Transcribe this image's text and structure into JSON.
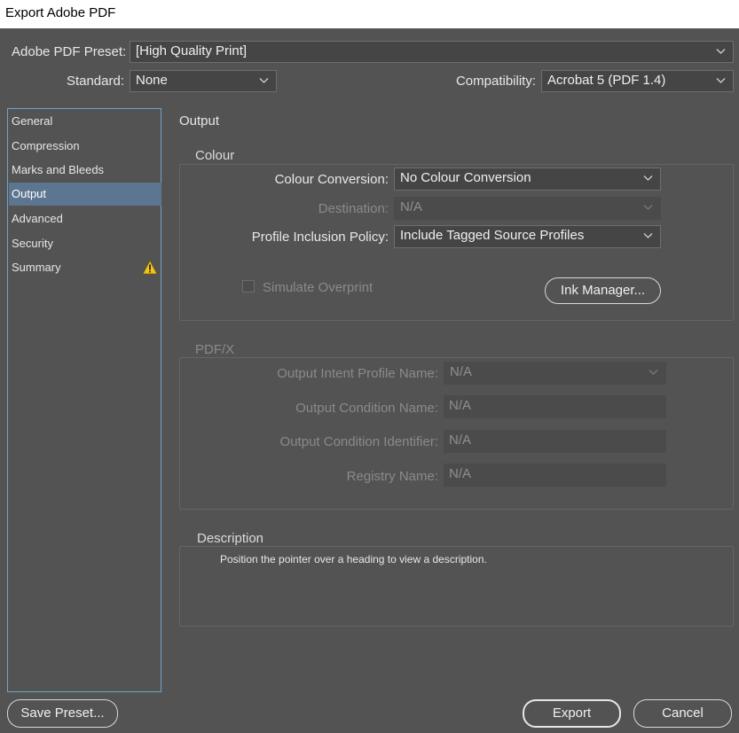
{
  "window": {
    "title": "Export Adobe PDF"
  },
  "header": {
    "preset_label": "Adobe PDF Preset:",
    "preset_value": "[High Quality Print]",
    "standard_label": "Standard:",
    "standard_value": "None",
    "compat_label": "Compatibility:",
    "compat_value": "Acrobat 5 (PDF 1.4)"
  },
  "sidebar": {
    "items": [
      {
        "label": "General"
      },
      {
        "label": "Compression"
      },
      {
        "label": "Marks and Bleeds"
      },
      {
        "label": "Output"
      },
      {
        "label": "Advanced"
      },
      {
        "label": "Security"
      },
      {
        "label": "Summary"
      }
    ],
    "selected": "Output",
    "warning_icon": "warning-triangle-icon"
  },
  "panel": {
    "title": "Output"
  },
  "colour": {
    "label": "Colour",
    "conversion_label": "Colour Conversion:",
    "conversion_value": "No Colour Conversion",
    "destination_label": "Destination:",
    "destination_value": "N/A",
    "profile_label": "Profile Inclusion Policy:",
    "profile_value": "Include Tagged Source Profiles",
    "simulate_label": "Simulate Overprint",
    "ink_manager_label": "Ink Manager..."
  },
  "pdfx": {
    "label": "PDF/X",
    "intent_label": "Output Intent Profile Name:",
    "intent_value": "N/A",
    "condition_name_label": "Output Condition Name:",
    "condition_name_value": "N/A",
    "condition_id_label": "Output Condition Identifier:",
    "condition_id_value": "N/A",
    "registry_label": "Registry Name:",
    "registry_value": "N/A"
  },
  "description": {
    "label": "Description",
    "text": "Position the pointer over a heading to view a description."
  },
  "footer": {
    "save_preset": "Save Preset...",
    "export": "Export",
    "cancel": "Cancel"
  },
  "colors": {
    "background": "#535353",
    "selection": "#5c7590",
    "sidebar_border": "#6ea3c9",
    "warning": "#f0c419"
  }
}
